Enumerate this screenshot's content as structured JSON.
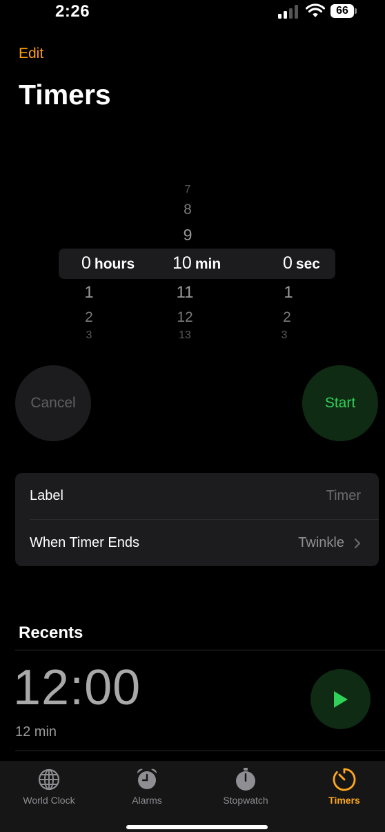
{
  "status_bar": {
    "time": "2:26",
    "battery": "66"
  },
  "header": {
    "edit_label": "Edit",
    "title": "Timers"
  },
  "picker": {
    "hours": {
      "value": "0",
      "unit": "hours",
      "above": [],
      "below": [
        "1",
        "2",
        "3"
      ]
    },
    "minutes": {
      "value": "10",
      "unit": "min",
      "above": [
        "7",
        "8",
        "9"
      ],
      "below": [
        "11",
        "12",
        "13"
      ]
    },
    "seconds": {
      "value": "0",
      "unit": "sec",
      "above": [],
      "below": [
        "1",
        "2",
        "3"
      ]
    }
  },
  "buttons": {
    "cancel": "Cancel",
    "start": "Start"
  },
  "settings": {
    "label_title": "Label",
    "label_placeholder": "Timer",
    "when_ends_title": "When Timer Ends",
    "when_ends_value": "Twinkle"
  },
  "recents": {
    "title": "Recents",
    "items": [
      {
        "time": "12:00",
        "duration": "12 min"
      }
    ]
  },
  "tabs": [
    {
      "label": "World Clock",
      "icon": "globe-icon"
    },
    {
      "label": "Alarms",
      "icon": "alarm-clock-icon"
    },
    {
      "label": "Stopwatch",
      "icon": "stopwatch-icon"
    },
    {
      "label": "Timers",
      "icon": "timer-icon"
    }
  ],
  "colors": {
    "accent": "#ff9f0a",
    "start_green": "#30d158",
    "tab_active": "#ffa81f"
  }
}
